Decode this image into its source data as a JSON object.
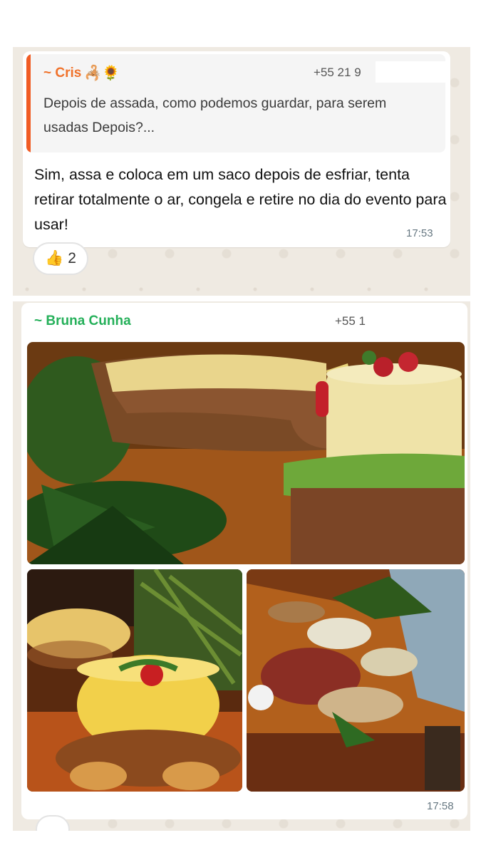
{
  "messages": [
    {
      "quote": {
        "author": "~ Cris",
        "author_emoji": "🦂🌻",
        "phone": "+55 21 9",
        "text": "Depois de assada, como podemos guardar, para serem usadas Depois?..."
      },
      "text": "Sim, assa e coloca em um saco depois de esfriar, tenta retirar totalmente o ar, congela e retire no dia do evento para usar!",
      "time": "17:53",
      "reaction": {
        "emoji": "👍",
        "count": "2"
      }
    },
    {
      "author": "~ Bruna Cunha",
      "phone": "+55 1",
      "photos": [
        "cheese-board-photo",
        "snacks-bowl-photo",
        "buffet-table-photo"
      ],
      "time": "17:58"
    }
  ],
  "colors": {
    "quote_bar": "#f15c24",
    "quote_author": "#f0722b",
    "author_green": "#25b05a",
    "chat_bg": "#efeae2"
  }
}
